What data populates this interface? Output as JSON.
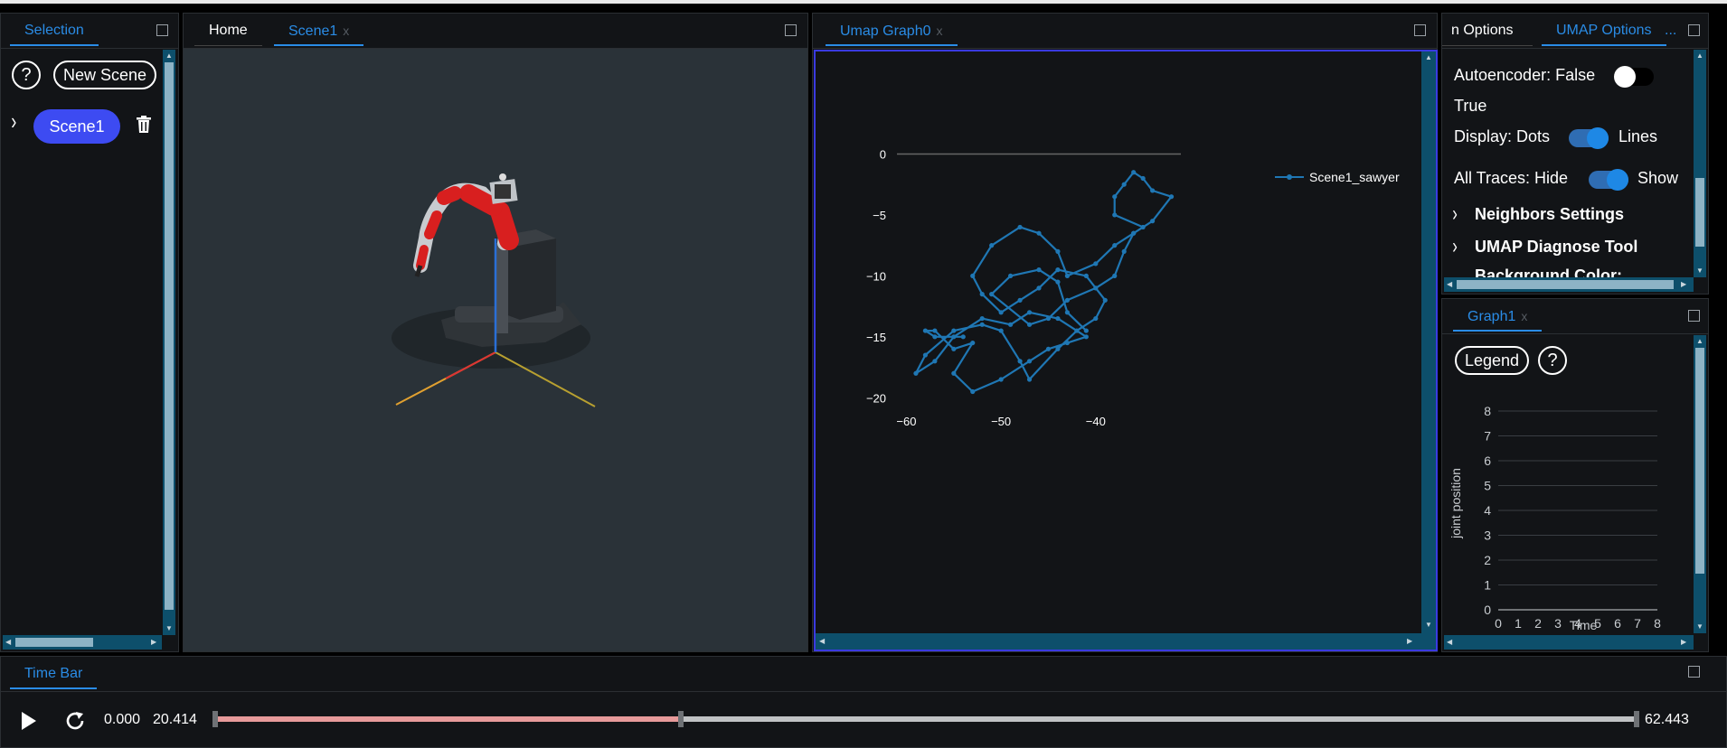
{
  "selection_panel": {
    "tab": "Selection",
    "help": "?",
    "new_scene": "New Scene",
    "scene_chevron": "›",
    "scene_item": "Scene1"
  },
  "scene_panel": {
    "tabs": [
      {
        "label": "Home"
      },
      {
        "label": "Scene1",
        "close": "x"
      }
    ]
  },
  "umap_panel": {
    "tab": "Umap Graph0",
    "close": "x",
    "chart_data": {
      "type": "line",
      "series": [
        {
          "name": "Scene1_sawyer",
          "x": [
            -54,
            -57,
            -58,
            -57,
            -55,
            -53,
            -55,
            -53,
            -50,
            -47,
            -45,
            -43,
            -41,
            -44,
            -47,
            -49,
            -52,
            -55,
            -57,
            -59,
            -58,
            -55,
            -52,
            -50,
            -48,
            -47,
            -44,
            -42,
            -40,
            -39,
            -41,
            -44,
            -46,
            -48,
            -50,
            -52,
            -53,
            -51,
            -48,
            -46,
            -44,
            -43,
            -40,
            -38,
            -36,
            -35,
            -38,
            -38,
            -37,
            -36,
            -35,
            -34,
            -32,
            -34,
            -36,
            -37,
            -38,
            -40,
            -43,
            -45,
            -47,
            -51,
            -49,
            -46,
            -44,
            -43,
            -41
          ],
          "y": [
            -15,
            -15,
            -14.5,
            -14.5,
            -16,
            -15.5,
            -18,
            -19.5,
            -18.5,
            -17,
            -16,
            -15.5,
            -15,
            -13.5,
            -13,
            -14,
            -13.5,
            -15,
            -17,
            -18,
            -16.5,
            -14.5,
            -14,
            -14.5,
            -17,
            -18.5,
            -16,
            -14.5,
            -13.5,
            -12,
            -10,
            -9.5,
            -11,
            -12,
            -13,
            -11.5,
            -10,
            -7.5,
            -6,
            -6.5,
            -8,
            -10,
            -9,
            -7.5,
            -6.5,
            -6,
            -5,
            -3.5,
            -2.5,
            -1.5,
            -2,
            -3,
            -3.5,
            -5.5,
            -6.5,
            -8,
            -10,
            -11,
            -12,
            -13.5,
            -14,
            -11.5,
            -10,
            -9.5,
            -10.5,
            -13,
            -14.5
          ]
        }
      ],
      "xlim": [
        -61,
        -31
      ],
      "ylim": [
        -20.5,
        1
      ],
      "xticks": [
        {
          "v": -60,
          "label": "−60"
        },
        {
          "v": -50,
          "label": "−50"
        },
        {
          "v": -40,
          "label": "−40"
        }
      ],
      "yticks": [
        {
          "v": 0,
          "label": "0"
        },
        {
          "v": -5,
          "label": "−5"
        },
        {
          "v": -10,
          "label": "−10"
        },
        {
          "v": -15,
          "label": "−15"
        },
        {
          "v": -20,
          "label": "−20"
        }
      ],
      "legend_position": "top-right",
      "color": "#1f77b4"
    }
  },
  "umap_options": {
    "tabs": [
      {
        "label": "n Options"
      },
      {
        "label": "UMAP Options"
      },
      {
        "label": "..."
      }
    ],
    "autoencoder_label": "Autoencoder: False",
    "autoencoder_true": "True",
    "display_label": "Display: Dots",
    "display_lines": "Lines",
    "traces_label": "All Traces: Hide",
    "traces_show": "Show",
    "neighbors": "Neighbors Settings",
    "diagnose": "UMAP Diagnose Tool",
    "background": "Background Color:"
  },
  "graph1_panel": {
    "tab": "Graph1",
    "close": "x",
    "legend_btn": "Legend",
    "help": "?",
    "chart_data": {
      "type": "line",
      "series": [],
      "xticks": [
        "0",
        "1",
        "2",
        "3",
        "4",
        "5",
        "6",
        "7",
        "8"
      ],
      "yticks": [
        "0",
        "1",
        "2",
        "3",
        "4",
        "5",
        "6",
        "7",
        "8"
      ],
      "xlabel": "Time",
      "ylabel": "joint position",
      "xlim": [
        0,
        8
      ],
      "ylim": [
        0,
        8
      ],
      "grid": true
    }
  },
  "timebar": {
    "tab": "Time Bar",
    "start": "0.000",
    "current": "20.414",
    "end": "62.443",
    "progress": 0.327
  }
}
